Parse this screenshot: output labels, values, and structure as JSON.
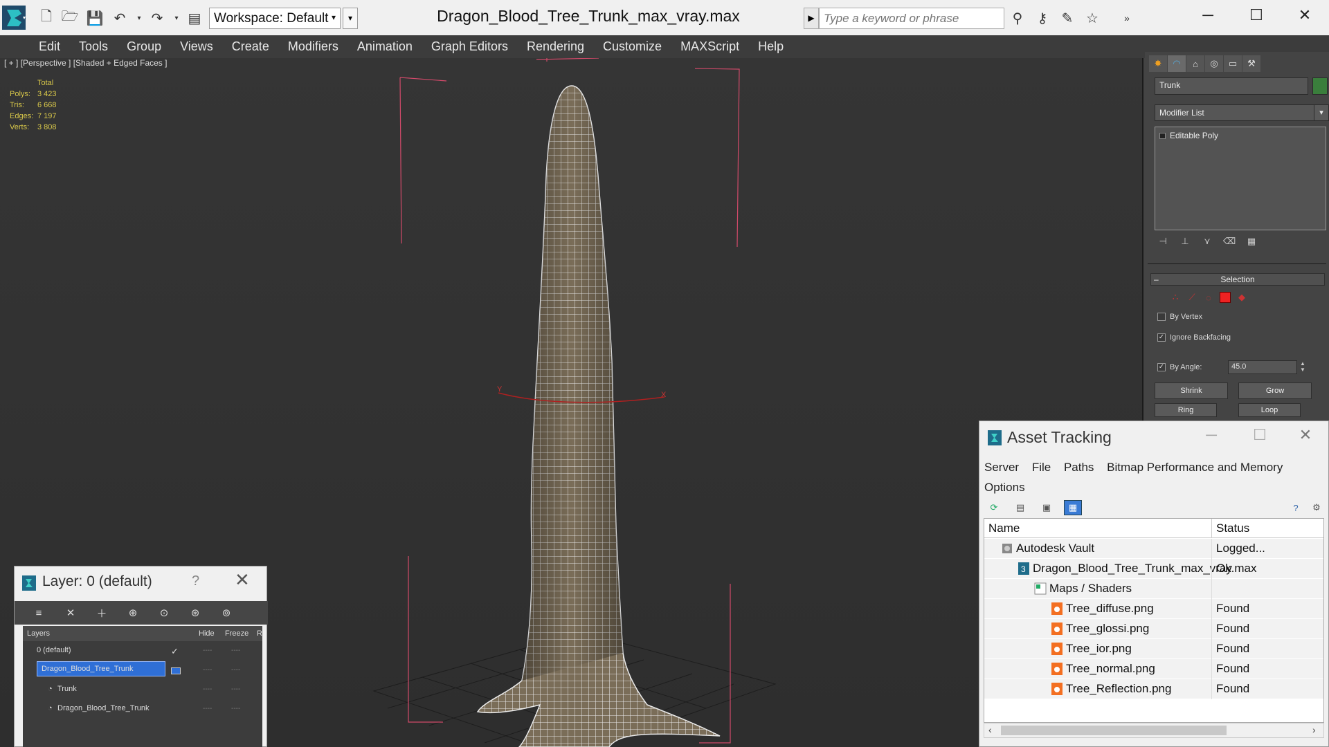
{
  "titlebar": {
    "workspace_label": "Workspace: Default",
    "document_title": "Dragon_Blood_Tree_Trunk_max_vray.max",
    "search_placeholder": "Type a keyword or phrase"
  },
  "menubar": {
    "items": [
      "Edit",
      "Tools",
      "Group",
      "Views",
      "Create",
      "Modifiers",
      "Animation",
      "Graph Editors",
      "Rendering",
      "Customize",
      "MAXScript",
      "Help"
    ]
  },
  "viewport": {
    "label": "[ + ] [Perspective ] [Shaded + Edged Faces ]",
    "stats": {
      "header": "Total",
      "rows": [
        {
          "key": "Polys:",
          "value": "3 423"
        },
        {
          "key": "Tris:",
          "value": "6 668"
        },
        {
          "key": "Edges:",
          "value": "7 197"
        },
        {
          "key": "Verts:",
          "value": "3 808"
        }
      ]
    },
    "gizmo_x": "X",
    "gizmo_y": "Y"
  },
  "command_panel": {
    "object_name": "Trunk",
    "object_color": "#3a7e3c",
    "modifier_list_label": "Modifier List",
    "stack_entry": "Editable Poly",
    "selection": {
      "title": "Selection",
      "by_vertex": "By Vertex",
      "ignore_backfacing": "Ignore Backfacing",
      "by_angle": "By Angle:",
      "angle_value": "45.0",
      "shrink": "Shrink",
      "grow": "Grow",
      "ring": "Ring",
      "loop": "Loop"
    }
  },
  "asset_tracking": {
    "title": "Asset Tracking",
    "menu": [
      "Server",
      "File",
      "Paths",
      "Bitmap Performance and Memory",
      "Options"
    ],
    "columns": {
      "name": "Name",
      "status": "Status"
    },
    "rows": [
      {
        "name": "Autodesk Vault",
        "status": "Logged...",
        "icon": "vault-icon"
      },
      {
        "name": "Dragon_Blood_Tree_Trunk_max_vray.max",
        "status": "Ok",
        "icon": "max-file-icon"
      },
      {
        "name": "Maps / Shaders",
        "status": "",
        "icon": "maps-icon"
      },
      {
        "name": "Tree_diffuse.png",
        "status": "Found",
        "icon": "png-file-icon"
      },
      {
        "name": "Tree_glossi.png",
        "status": "Found",
        "icon": "png-file-icon"
      },
      {
        "name": "Tree_ior.png",
        "status": "Found",
        "icon": "png-file-icon"
      },
      {
        "name": "Tree_normal.png",
        "status": "Found",
        "icon": "png-file-icon"
      },
      {
        "name": "Tree_Reflection.png",
        "status": "Found",
        "icon": "png-file-icon"
      }
    ]
  },
  "layer_explorer": {
    "title": "Layer: 0 (default)",
    "help": "?",
    "columns": {
      "layers": "Layers",
      "hide": "Hide",
      "freeze": "Freeze",
      "render": "R"
    },
    "rows": [
      {
        "name": "0 (default)",
        "selected": false
      },
      {
        "name": "Dragon_Blood_Tree_Trunk",
        "selected": true
      },
      {
        "name": "Trunk",
        "selected": false
      },
      {
        "name": "Dragon_Blood_Tree_Trunk",
        "selected": false
      }
    ],
    "dash": "----"
  }
}
